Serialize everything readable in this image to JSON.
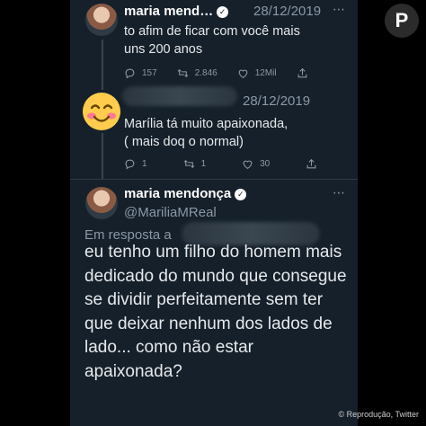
{
  "brand": {
    "logo_letter": "P"
  },
  "credit": "© Reprodução, Twitter",
  "tweet1": {
    "name": "maria mend…",
    "date": "28/12/2019",
    "text_lines": [
      "to afim de ficar com você mais",
      "uns 200 anos"
    ],
    "reply_count": "157",
    "retweet_count": "2.846",
    "like_count": "12Mil"
  },
  "tweet2": {
    "date": "28/12/2019",
    "text_lines": [
      "Marília tá muito apaixonada,",
      "( mais doq o normal)"
    ],
    "reply_count": "1",
    "retweet_count": "1",
    "like_count": "30"
  },
  "main_tweet": {
    "name": "maria mendonça",
    "handle": "@MariliaMReal",
    "reply_prefix": "Em resposta a",
    "text": "eu tenho um filho do homem mais dedicado do mundo que consegue se dividir perfeitamente sem ter que deixar nenhum dos lados de lado... como não estar apaixonada?"
  },
  "icons": {
    "verified": "verified-badge-icon",
    "reply": "reply-icon",
    "retweet": "retweet-icon",
    "like": "like-icon",
    "share": "share-icon",
    "more": "more-icon"
  },
  "colors": {
    "background": "#15202b",
    "text": "#e7e9ea",
    "muted": "#8b98a5"
  }
}
